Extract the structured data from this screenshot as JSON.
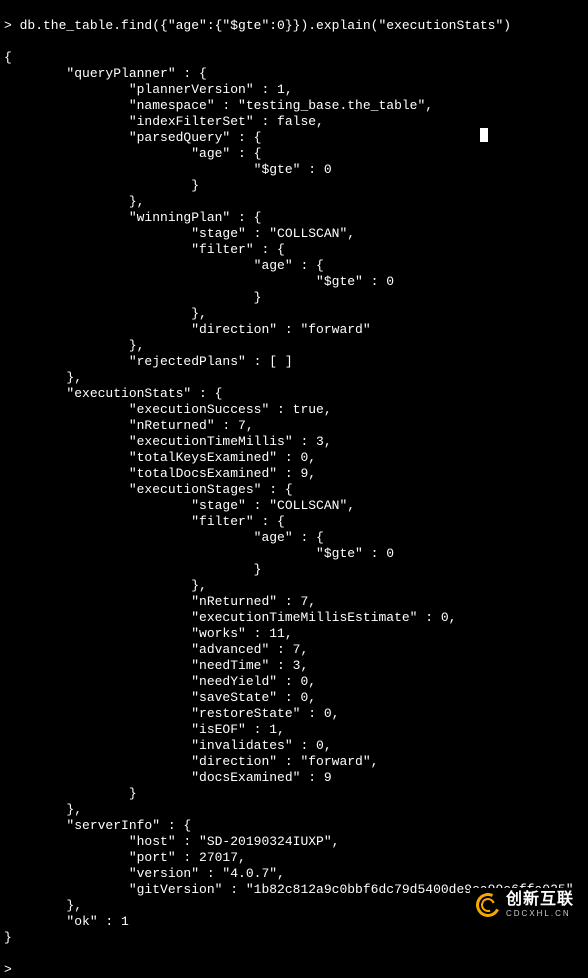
{
  "command": "> db.the_table.find({\"age\":{\"$gte\":0}}).explain(\"executionStats\")",
  "result": {
    "queryPlanner": {
      "plannerVersion": 1,
      "namespace": "testing_base.the_table",
      "indexFilterSet": false,
      "parsedQuery": {
        "age": {
          "$gte": 0
        }
      },
      "winningPlan": {
        "stage": "COLLSCAN",
        "filter": {
          "age": {
            "$gte": 0
          }
        },
        "direction": "forward"
      },
      "rejectedPlans": []
    },
    "executionStats": {
      "executionSuccess": true,
      "nReturned": 7,
      "executionTimeMillis": 3,
      "totalKeysExamined": 0,
      "totalDocsExamined": 9,
      "executionStages": {
        "stage": "COLLSCAN",
        "filter": {
          "age": {
            "$gte": 0
          }
        },
        "nReturned": 7,
        "executionTimeMillisEstimate": 0,
        "works": 11,
        "advanced": 7,
        "needTime": 3,
        "needYield": 0,
        "saveState": 0,
        "restoreState": 0,
        "isEOF": 1,
        "invalidates": 0,
        "direction": "forward",
        "docsExamined": 9
      }
    },
    "serverInfo": {
      "host": "SD-20190324IUXP",
      "port": 27017,
      "version": "4.0.7",
      "gitVersion": "1b82c812a9c0bbf6dc79d5400de9ea99e6ffa025"
    },
    "ok": 1
  },
  "watermark": {
    "main": "创新互联",
    "sub": "CDCXHL.CN"
  }
}
